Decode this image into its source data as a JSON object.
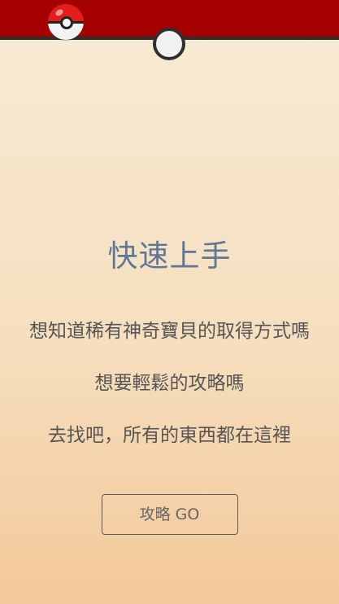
{
  "header": {
    "logo_icon": "pokeball-icon",
    "center_icon": "circle-button-icon",
    "bar_color": "#a40000",
    "bar_border_color": "#2f2f2f"
  },
  "main": {
    "title": "快速上手",
    "line_1": "想知道稀有神奇寶貝的取得方式嗎",
    "line_2": "想要輕鬆的攻略嗎",
    "line_3": "去找吧，所有的東西都在這裡",
    "button_label": "攻略 GO"
  },
  "colors": {
    "title": "#5f7896",
    "text": "#555555",
    "button_border": "#5b5b5b",
    "background_top": "#f8ebd6",
    "background_bottom": "#f3c99a"
  }
}
